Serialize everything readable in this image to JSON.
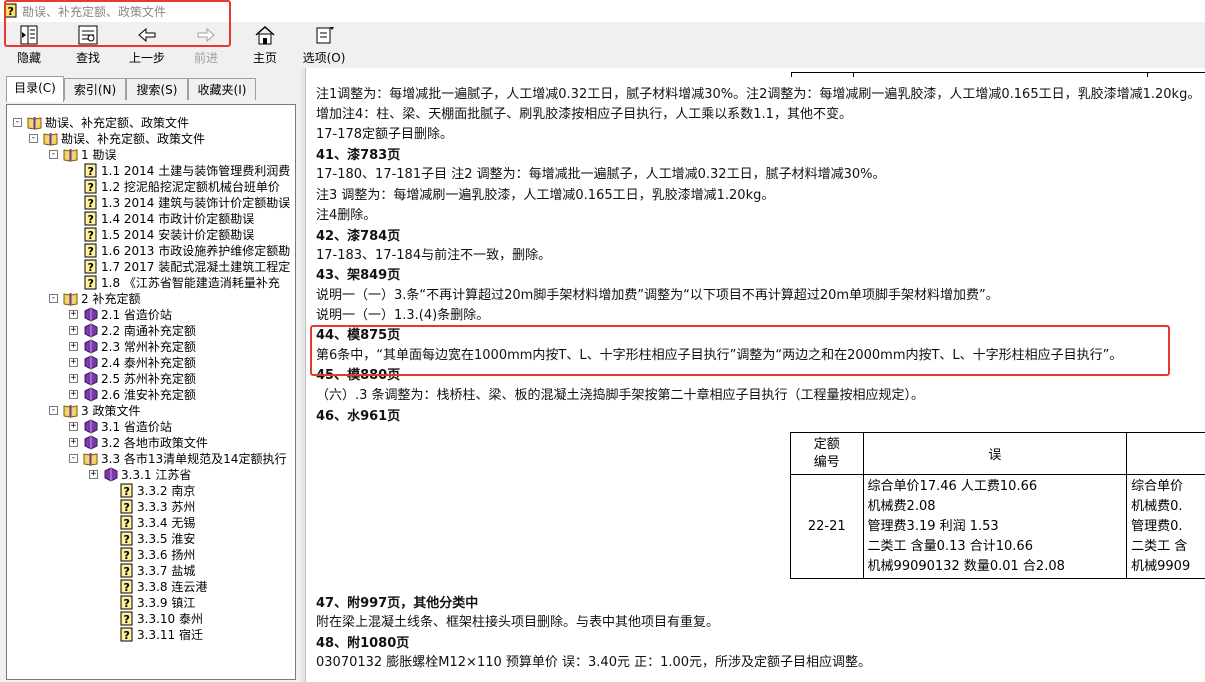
{
  "window": {
    "title": "勘误、补充定额、政策文件"
  },
  "toolbar": {
    "buttons": [
      {
        "label": "隐藏",
        "icon": "hide-pane-icon"
      },
      {
        "label": "查找",
        "icon": "find-icon"
      },
      {
        "label": "上一步",
        "icon": "back-arrow-icon"
      },
      {
        "label": "前进",
        "icon": "forward-arrow-icon"
      },
      {
        "label": "主页",
        "icon": "home-icon"
      },
      {
        "label": "选项(O)",
        "icon": "options-icon"
      }
    ]
  },
  "tabs": [
    "目录(C)",
    "索引(N)",
    "搜索(S)",
    "收藏夹(I)"
  ],
  "tree": [
    {
      "label": "勘误、补充定额、政策文件",
      "level": 0,
      "icon": "book",
      "exp": "-"
    },
    {
      "label": "勘误、补充定额、政策文件",
      "level": 1,
      "icon": "book",
      "exp": "-"
    },
    {
      "label": "1 勘误",
      "level": 2,
      "icon": "book",
      "exp": "-"
    },
    {
      "label": "1.1 2014 土建与装饰管理费利润费",
      "level": 3,
      "icon": "page",
      "exp": ""
    },
    {
      "label": "1.2 挖泥船挖泥定额机械台班单价",
      "level": 3,
      "icon": "page",
      "exp": ""
    },
    {
      "label": "1.3 2014 建筑与装饰计价定额勘误",
      "level": 3,
      "icon": "page",
      "exp": ""
    },
    {
      "label": "1.4 2014 市政计价定额勘误",
      "level": 3,
      "icon": "page",
      "exp": ""
    },
    {
      "label": "1.5 2014 安装计价定额勘误",
      "level": 3,
      "icon": "page",
      "exp": ""
    },
    {
      "label": "1.6 2013 市政设施养护维修定额勘",
      "level": 3,
      "icon": "page",
      "exp": ""
    },
    {
      "label": "1.7 2017 装配式混凝土建筑工程定",
      "level": 3,
      "icon": "page",
      "exp": ""
    },
    {
      "label": "1.8 《江苏省智能建造消耗量补充",
      "level": 3,
      "icon": "page",
      "exp": ""
    },
    {
      "label": "2 补充定额",
      "level": 2,
      "icon": "book",
      "exp": "-"
    },
    {
      "label": "2.1 省造价站",
      "level": 3,
      "icon": "closed-book",
      "exp": "+"
    },
    {
      "label": "2.2 南通补充定额",
      "level": 3,
      "icon": "closed-book",
      "exp": "+"
    },
    {
      "label": "2.3 常州补充定额",
      "level": 3,
      "icon": "closed-book",
      "exp": "+"
    },
    {
      "label": "2.4 泰州补充定额",
      "level": 3,
      "icon": "closed-book",
      "exp": "+"
    },
    {
      "label": "2.5 苏州补充定额",
      "level": 3,
      "icon": "closed-book",
      "exp": "+"
    },
    {
      "label": "2.6 淮安补充定额",
      "level": 3,
      "icon": "closed-book",
      "exp": "+"
    },
    {
      "label": "3 政策文件",
      "level": 2,
      "icon": "book",
      "exp": "-"
    },
    {
      "label": "3.1 省造价站",
      "level": 3,
      "icon": "closed-book",
      "exp": "+"
    },
    {
      "label": "3.2 各地市政策文件",
      "level": 3,
      "icon": "closed-book",
      "exp": "+"
    },
    {
      "label": "3.3 各市13清单规范及14定额执行",
      "level": 3,
      "icon": "book",
      "exp": "-"
    },
    {
      "label": "3.3.1 江苏省",
      "level": 4,
      "icon": "closed-book",
      "exp": "+"
    },
    {
      "label": "3.3.2 南京",
      "level": 5,
      "icon": "page",
      "exp": ""
    },
    {
      "label": "3.3.3 苏州",
      "level": 5,
      "icon": "page",
      "exp": ""
    },
    {
      "label": "3.3.4 无锡",
      "level": 5,
      "icon": "page",
      "exp": ""
    },
    {
      "label": "3.3.5 淮安",
      "level": 5,
      "icon": "page",
      "exp": ""
    },
    {
      "label": "3.3.6 扬州",
      "level": 5,
      "icon": "page",
      "exp": ""
    },
    {
      "label": "3.3.7 盐城",
      "level": 5,
      "icon": "page",
      "exp": ""
    },
    {
      "label": "3.3.8 连云港",
      "level": 5,
      "icon": "page",
      "exp": ""
    },
    {
      "label": "3.3.9 镇江",
      "level": 5,
      "icon": "page",
      "exp": ""
    },
    {
      "label": "3.3.10 泰州",
      "level": 5,
      "icon": "page",
      "exp": ""
    },
    {
      "label": "3.3.11 宿迁",
      "level": 5,
      "icon": "page",
      "exp": ""
    }
  ],
  "content": {
    "lines": [
      {
        "text": "注1调整为：每增减批一遍腻子，人工增减0.32工日，腻子材料增减30%。注2调整为：每增减刷一遍乳胶漆，人工增减0.165工日，乳胶漆增减1.20kg。",
        "h": false
      },
      {
        "text": "增加注4：柱、梁、天棚面批腻子、刷乳胶漆按相应子目执行，人工乘以系数1.1，其他不变。",
        "h": false
      },
      {
        "text": "17-178定额子目删除。",
        "h": false
      },
      {
        "text": "41、漆783页",
        "h": true
      },
      {
        "text": "17-180、17-181子目 注2 调整为：每增减批一遍腻子，人工增减0.32工日，腻子材料增减30%。",
        "h": false
      },
      {
        "text": "注3 调整为：每增减刷一遍乳胶漆，人工增减0.165工日，乳胶漆增减1.20kg。",
        "h": false
      },
      {
        "text": "注4删除。",
        "h": false
      },
      {
        "text": "42、漆784页",
        "h": true
      },
      {
        "text": "17-183、17-184与前注不一致，删除。",
        "h": false
      },
      {
        "text": "43、架849页",
        "h": true
      },
      {
        "text": "说明一（一）3.条“不再计算超过20m脚手架材料增加费”调整为“以下项目不再计算超过20m单项脚手架材料增加费”。",
        "h": false
      },
      {
        "text": "说明一（一）1.3.(4)条删除。",
        "h": false
      },
      {
        "text": "44、模875页",
        "h": true
      },
      {
        "text": "第6条中，“其单面每边宽在1000mm内按T、L、十字形柱相应子目执行”调整为“两边之和在2000mm内按T、L、十字形柱相应子目执行”。",
        "h": false
      },
      {
        "text": "45、模880页",
        "h": true
      },
      {
        "text": "（六）.3 条调整为：栈桥柱、梁、板的混凝土浇捣脚手架按第二十章相应子目执行（工程量按相应规定）。",
        "h": false
      },
      {
        "text": "46、水961页",
        "h": true
      }
    ],
    "lines_after": [
      {
        "text": "47、附997页，其他分类中",
        "h": true
      },
      {
        "text": "附在梁上混凝土线条、框架柱接头项目删除。与表中其他项目有重复。",
        "h": false
      },
      {
        "text": "48、附1080页",
        "h": true
      },
      {
        "text": "03070132 膨胀螺栓M12×110 预算单价 误：3.40元 正：1.00元，所涉及定额子目相应调整。",
        "h": false
      }
    ],
    "table": {
      "header": [
        "定额\n编号",
        "误",
        ""
      ],
      "code": "22-21",
      "error_lines": [
        "综合单价17.46 人工费10.66",
        "机械费2.08",
        "管理费3.19 利润  1.53",
        "二类工 含量0.13 合计10.66",
        "机械99090132 数量0.01 合2.08"
      ],
      "correct_lines": [
        "综合单价",
        "机械费0.",
        "管理费0.",
        "二类工 含",
        "机械9909"
      ]
    }
  }
}
